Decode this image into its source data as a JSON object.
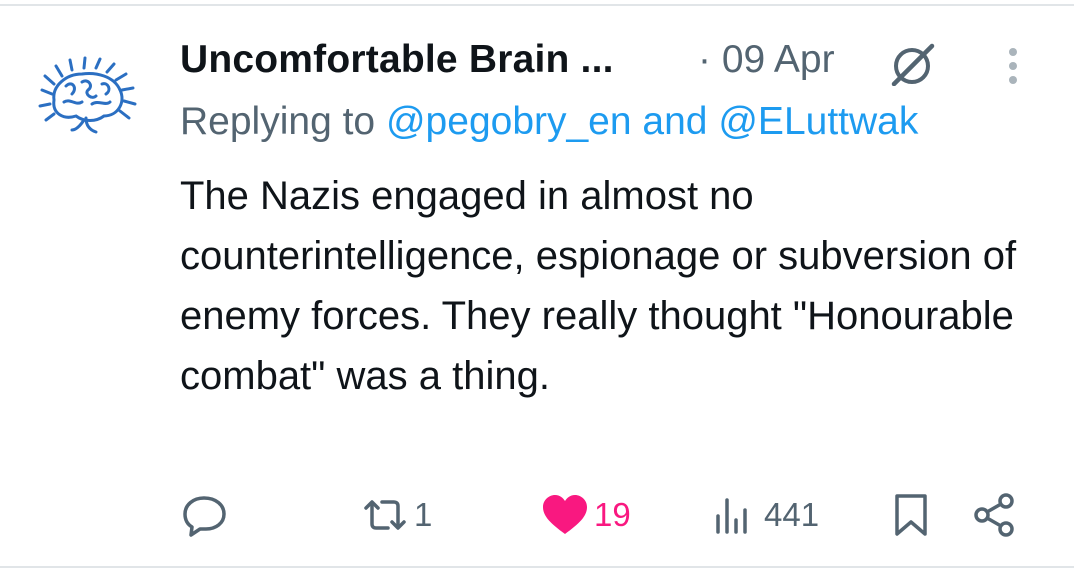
{
  "tweet": {
    "author_name": "Uncomfortable Brain ...",
    "separator": "·",
    "date": "09 Apr",
    "reply_prefix": "Replying to",
    "mention_1": "@pegobry_en",
    "reply_and": "and",
    "mention_2": "@ELuttwak",
    "text": "The Nazis engaged in almost no counterintelligence, espionage or subversion of enemy forces. They really thought \"Honourable combat\" was a thing.",
    "reposts": "1",
    "likes": "19",
    "views": "441",
    "liked": true
  },
  "icons": {
    "avatar": "brain-logo",
    "grok": "grok-icon",
    "more": "more-vertical-icon",
    "reply": "reply-icon",
    "repost": "repost-icon",
    "like": "heart-icon",
    "views": "views-icon",
    "bookmark": "bookmark-icon",
    "share": "share-icon"
  },
  "colors": {
    "text": "#0f1419",
    "muted": "#536471",
    "link": "#1d9bf0",
    "like": "#f91880",
    "avatar": "#2b6fc2"
  }
}
